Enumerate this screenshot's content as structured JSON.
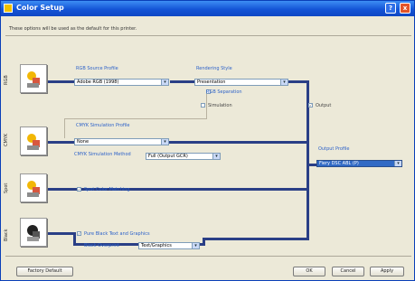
{
  "window": {
    "title": "Color Setup",
    "help_glyph": "?",
    "close_glyph": "x"
  },
  "intro_text": "These options will be used as the default for this printer.",
  "rows": {
    "rgb": "RGB",
    "cmyk": "CMYK",
    "spot": "Spot",
    "black": "Black"
  },
  "rgb_source_profile": {
    "label": "RGB Source Profile",
    "value": "Adobe RGB (1998)"
  },
  "rendering_style": {
    "label": "Rendering Style",
    "value": "Presentation"
  },
  "rgb_separation": {
    "label": "RGB Separation",
    "checkbox": "Simulation",
    "checked": false
  },
  "output_checkbox": {
    "label": "Output",
    "checked": true
  },
  "cmyk_simulation_profile": {
    "label": "CMYK Simulation Profile",
    "value": "None"
  },
  "cmyk_simulation_method": {
    "label": "CMYK Simulation Method",
    "value": "Full (Output GCR)"
  },
  "output_profile": {
    "label": "Output Profile",
    "value": "Fiery DSC ABL (P)"
  },
  "spot_color_matching": {
    "label": "Spot Color Matching",
    "checked": true
  },
  "pure_black": {
    "label": "Pure Black Text and Graphics",
    "checked": true
  },
  "black_overprint": {
    "label": "Black Overprint",
    "value": "Text/Graphics"
  },
  "buttons": {
    "factory_default": "Factory Default",
    "ok": "OK",
    "cancel": "Cancel",
    "apply": "Apply"
  },
  "colors": {
    "title_bar": "#1454d6",
    "flow_line": "#2a3f86",
    "accent_label": "#2d62c9",
    "dialog_bg": "#ece9d8"
  }
}
